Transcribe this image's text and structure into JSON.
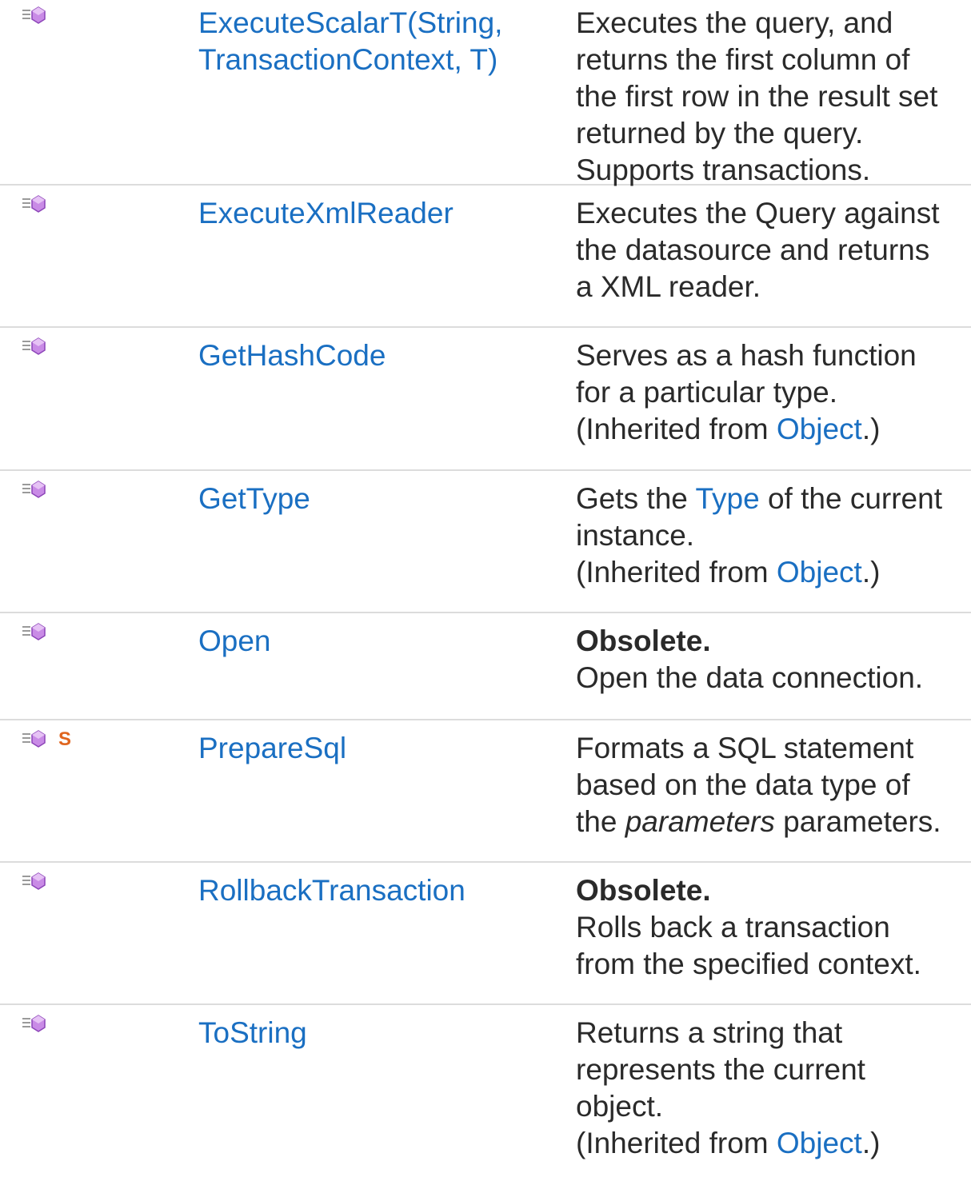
{
  "rows": [
    {
      "name": "ExecuteScalarT(String, TransactionContext, T)",
      "name_lines": [
        "ExecuteScalarT(String,",
        "TransactionContext, T)"
      ],
      "desc_lines": [
        "Executes the query, and",
        "returns the first column of",
        "the first row in the result set",
        "returned by the query.",
        "Supports transactions."
      ]
    },
    {
      "name": "ExecuteXmlReader",
      "desc_lines": [
        "Executes the Query against",
        "the datasource and returns",
        "a XML reader."
      ]
    },
    {
      "name": "GetHashCode",
      "desc_lines": [
        "Serves as a hash function",
        "for a particular type."
      ],
      "inherited_prefix": "(Inherited from ",
      "inherited_link": "Object",
      "inherited_suffix": ".)"
    },
    {
      "name": "GetType",
      "desc_prefix": "Gets the ",
      "desc_link": "Type",
      "desc_suffix": " of the current",
      "desc_lines": [
        "instance."
      ],
      "inherited_prefix": "(Inherited from ",
      "inherited_link": "Object",
      "inherited_suffix": ".)"
    },
    {
      "name": "Open",
      "obsolete": "Obsolete.",
      "desc_lines": [
        "Open the data connection."
      ]
    },
    {
      "name": "PrepareSql",
      "static_badge": "S",
      "desc_lines": [
        "Formats a SQL statement",
        "based on the data type of"
      ],
      "desc_tail_prefix": "the ",
      "desc_tail_param": "parameters",
      "desc_tail_suffix": " parameters."
    },
    {
      "name": "RollbackTransaction",
      "obsolete": "Obsolete.",
      "desc_lines": [
        "Rolls back a transaction",
        "from the specified context."
      ]
    },
    {
      "name": "ToString",
      "desc_lines": [
        "Returns a string that",
        "represents the current",
        "object."
      ],
      "inherited_prefix": "(Inherited from ",
      "inherited_link": "Object",
      "inherited_suffix": ".)"
    }
  ],
  "colors": {
    "link": "#1a6fc2",
    "text": "#2a2a2a",
    "divider": "#dcdcdc",
    "method_icon": "#b56fd8",
    "static_icon": "#e0651e"
  },
  "icons": {
    "method": "public-method-icon",
    "static": "static-member-icon"
  }
}
